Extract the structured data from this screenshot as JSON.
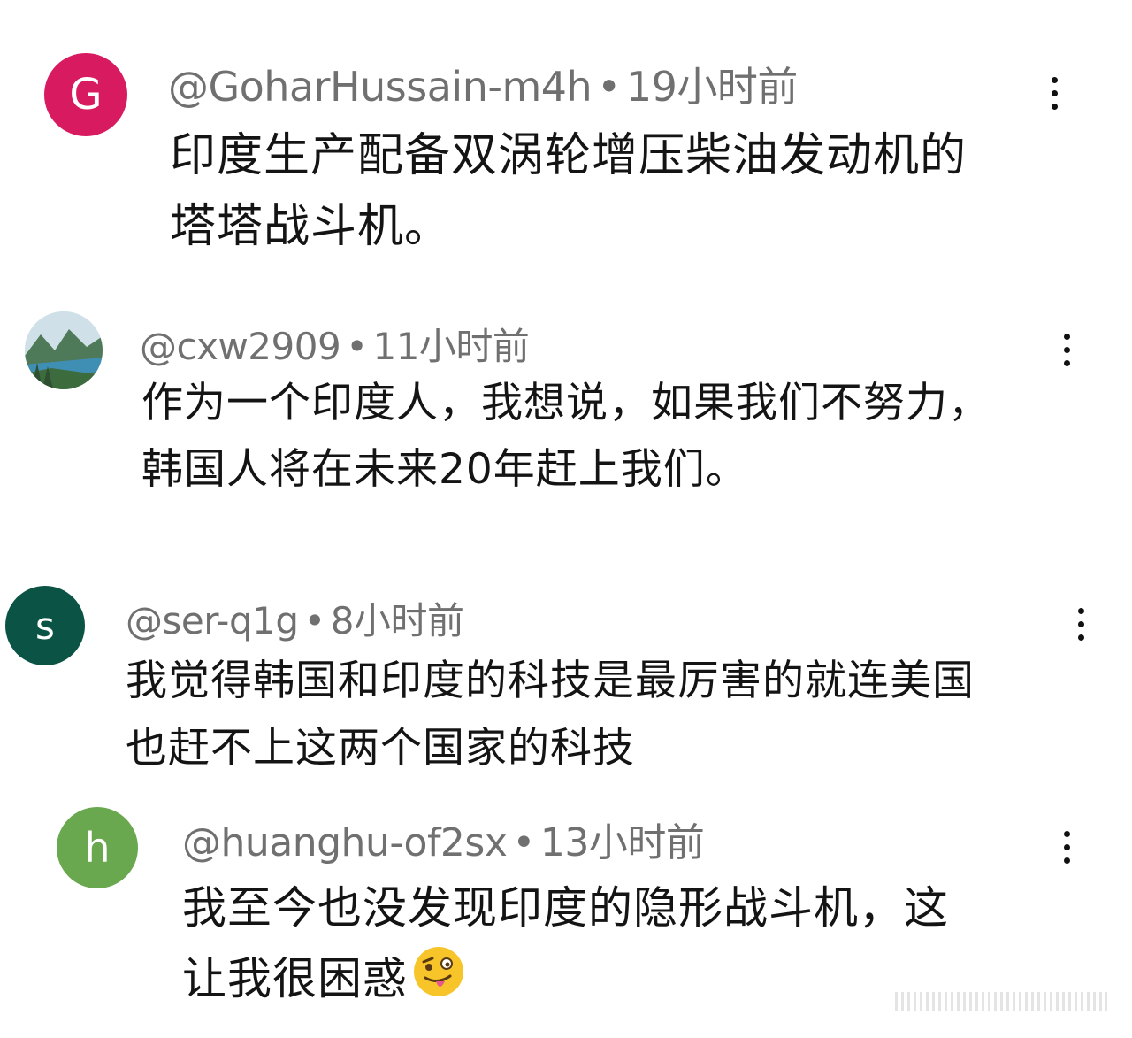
{
  "comments": [
    {
      "avatar_letter": "G",
      "avatar_color": "#d81b60",
      "username": "@GoharHussain-m4h",
      "separator": "•",
      "time": "19小时前",
      "lines": [
        "印度生产配备双涡轮增压柴油发动机的",
        "塔塔战斗机。"
      ]
    },
    {
      "avatar_letter": "",
      "avatar_icon": "landscape-photo-icon",
      "username": "@cxw2909",
      "separator": "•",
      "time": "11小时前",
      "lines": [
        "作为一个印度人，我想说，如果我们不努力，",
        "韩国人将在未来20年赶上我们。"
      ]
    },
    {
      "avatar_letter": "s",
      "avatar_color": "#0b5345",
      "username": "@ser-q1g",
      "separator": "•",
      "time": "8小时前",
      "lines": [
        "我觉得韩国和印度的科技是最厉害的就连美国",
        "也赶不上这两个国家的科技"
      ]
    },
    {
      "avatar_letter": "h",
      "avatar_color": "#6aa84f",
      "username": "@huanghu-of2sx",
      "separator": "•",
      "time": "13小时前",
      "lines": [
        "我至今也没发现印度的隐形战斗机，这",
        "让我很困惑"
      ],
      "emoji": "zany-face-icon"
    }
  ]
}
